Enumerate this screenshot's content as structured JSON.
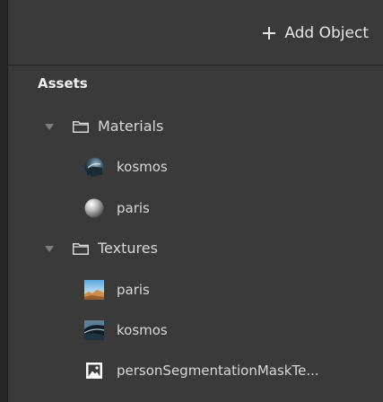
{
  "toolbar": {
    "add_object_label": "Add Object"
  },
  "assets": {
    "header": "Assets",
    "materials": {
      "label": "Materials",
      "items": [
        {
          "label": "kosmos",
          "icon": "space-material-thumbnail-icon"
        },
        {
          "label": "paris",
          "icon": "sphere-material-thumbnail-icon"
        }
      ]
    },
    "textures": {
      "label": "Textures",
      "items": [
        {
          "label": "paris",
          "icon": "paris-texture-thumbnail-icon"
        },
        {
          "label": "kosmos",
          "icon": "space-texture-thumbnail-icon"
        },
        {
          "label": "personSegmentationMaskTe...",
          "icon": "image-icon"
        }
      ]
    }
  },
  "colors": {
    "panel_bg": "#3a3a3a",
    "text": "#d8d8d8",
    "header_text": "#f0f0f0",
    "caret": "#7c7c7c"
  }
}
